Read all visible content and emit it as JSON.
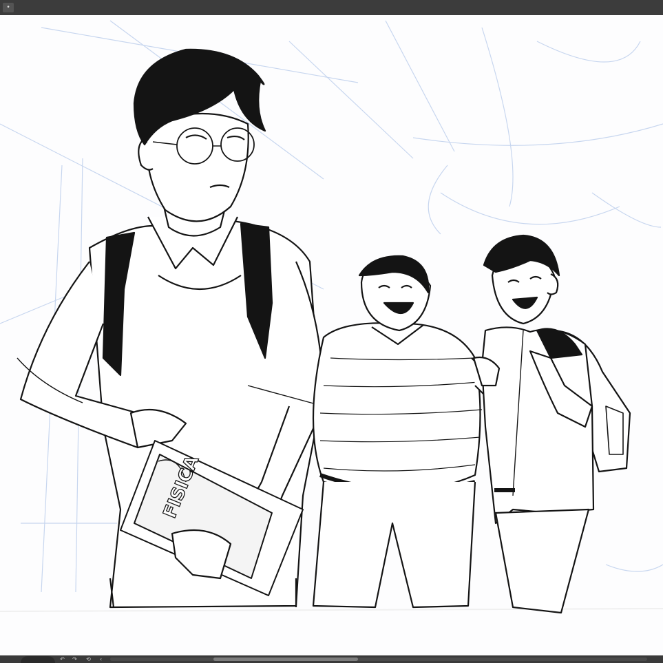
{
  "toolbar": {
    "menu_glyph": "•",
    "menu_icon": "menu-dot-icon"
  },
  "artwork": {
    "book_title": "FISICA",
    "sketch_color": "#c7d6ef",
    "ink_color": "#141414"
  },
  "statusbar": {
    "icons": [
      "undo-icon",
      "redo-icon",
      "rotate-icon",
      "collapse-icon"
    ],
    "glyphs": [
      "↶",
      "↷",
      "⟲",
      "‹"
    ]
  }
}
